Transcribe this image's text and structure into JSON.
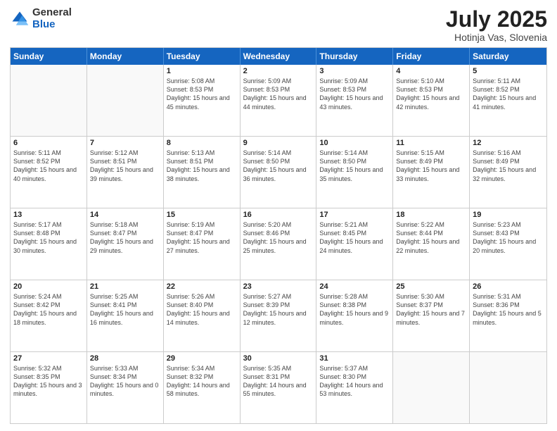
{
  "logo": {
    "general": "General",
    "blue": "Blue"
  },
  "header": {
    "month_year": "July 2025",
    "location": "Hotinja Vas, Slovenia"
  },
  "days_of_week": [
    "Sunday",
    "Monday",
    "Tuesday",
    "Wednesday",
    "Thursday",
    "Friday",
    "Saturday"
  ],
  "weeks": [
    [
      {
        "day": "",
        "empty": true
      },
      {
        "day": "",
        "empty": true
      },
      {
        "day": "1",
        "sunrise": "5:08 AM",
        "sunset": "8:53 PM",
        "daylight": "15 hours and 45 minutes."
      },
      {
        "day": "2",
        "sunrise": "5:09 AM",
        "sunset": "8:53 PM",
        "daylight": "15 hours and 44 minutes."
      },
      {
        "day": "3",
        "sunrise": "5:09 AM",
        "sunset": "8:53 PM",
        "daylight": "15 hours and 43 minutes."
      },
      {
        "day": "4",
        "sunrise": "5:10 AM",
        "sunset": "8:53 PM",
        "daylight": "15 hours and 42 minutes."
      },
      {
        "day": "5",
        "sunrise": "5:11 AM",
        "sunset": "8:52 PM",
        "daylight": "15 hours and 41 minutes."
      }
    ],
    [
      {
        "day": "6",
        "sunrise": "5:11 AM",
        "sunset": "8:52 PM",
        "daylight": "15 hours and 40 minutes."
      },
      {
        "day": "7",
        "sunrise": "5:12 AM",
        "sunset": "8:51 PM",
        "daylight": "15 hours and 39 minutes."
      },
      {
        "day": "8",
        "sunrise": "5:13 AM",
        "sunset": "8:51 PM",
        "daylight": "15 hours and 38 minutes."
      },
      {
        "day": "9",
        "sunrise": "5:14 AM",
        "sunset": "8:50 PM",
        "daylight": "15 hours and 36 minutes."
      },
      {
        "day": "10",
        "sunrise": "5:14 AM",
        "sunset": "8:50 PM",
        "daylight": "15 hours and 35 minutes."
      },
      {
        "day": "11",
        "sunrise": "5:15 AM",
        "sunset": "8:49 PM",
        "daylight": "15 hours and 33 minutes."
      },
      {
        "day": "12",
        "sunrise": "5:16 AM",
        "sunset": "8:49 PM",
        "daylight": "15 hours and 32 minutes."
      }
    ],
    [
      {
        "day": "13",
        "sunrise": "5:17 AM",
        "sunset": "8:48 PM",
        "daylight": "15 hours and 30 minutes."
      },
      {
        "day": "14",
        "sunrise": "5:18 AM",
        "sunset": "8:47 PM",
        "daylight": "15 hours and 29 minutes."
      },
      {
        "day": "15",
        "sunrise": "5:19 AM",
        "sunset": "8:47 PM",
        "daylight": "15 hours and 27 minutes."
      },
      {
        "day": "16",
        "sunrise": "5:20 AM",
        "sunset": "8:46 PM",
        "daylight": "15 hours and 25 minutes."
      },
      {
        "day": "17",
        "sunrise": "5:21 AM",
        "sunset": "8:45 PM",
        "daylight": "15 hours and 24 minutes."
      },
      {
        "day": "18",
        "sunrise": "5:22 AM",
        "sunset": "8:44 PM",
        "daylight": "15 hours and 22 minutes."
      },
      {
        "day": "19",
        "sunrise": "5:23 AM",
        "sunset": "8:43 PM",
        "daylight": "15 hours and 20 minutes."
      }
    ],
    [
      {
        "day": "20",
        "sunrise": "5:24 AM",
        "sunset": "8:42 PM",
        "daylight": "15 hours and 18 minutes."
      },
      {
        "day": "21",
        "sunrise": "5:25 AM",
        "sunset": "8:41 PM",
        "daylight": "15 hours and 16 minutes."
      },
      {
        "day": "22",
        "sunrise": "5:26 AM",
        "sunset": "8:40 PM",
        "daylight": "15 hours and 14 minutes."
      },
      {
        "day": "23",
        "sunrise": "5:27 AM",
        "sunset": "8:39 PM",
        "daylight": "15 hours and 12 minutes."
      },
      {
        "day": "24",
        "sunrise": "5:28 AM",
        "sunset": "8:38 PM",
        "daylight": "15 hours and 9 minutes."
      },
      {
        "day": "25",
        "sunrise": "5:30 AM",
        "sunset": "8:37 PM",
        "daylight": "15 hours and 7 minutes."
      },
      {
        "day": "26",
        "sunrise": "5:31 AM",
        "sunset": "8:36 PM",
        "daylight": "15 hours and 5 minutes."
      }
    ],
    [
      {
        "day": "27",
        "sunrise": "5:32 AM",
        "sunset": "8:35 PM",
        "daylight": "15 hours and 3 minutes."
      },
      {
        "day": "28",
        "sunrise": "5:33 AM",
        "sunset": "8:34 PM",
        "daylight": "15 hours and 0 minutes."
      },
      {
        "day": "29",
        "sunrise": "5:34 AM",
        "sunset": "8:32 PM",
        "daylight": "14 hours and 58 minutes."
      },
      {
        "day": "30",
        "sunrise": "5:35 AM",
        "sunset": "8:31 PM",
        "daylight": "14 hours and 55 minutes."
      },
      {
        "day": "31",
        "sunrise": "5:37 AM",
        "sunset": "8:30 PM",
        "daylight": "14 hours and 53 minutes."
      },
      {
        "day": "",
        "empty": true
      },
      {
        "day": "",
        "empty": true
      }
    ]
  ]
}
